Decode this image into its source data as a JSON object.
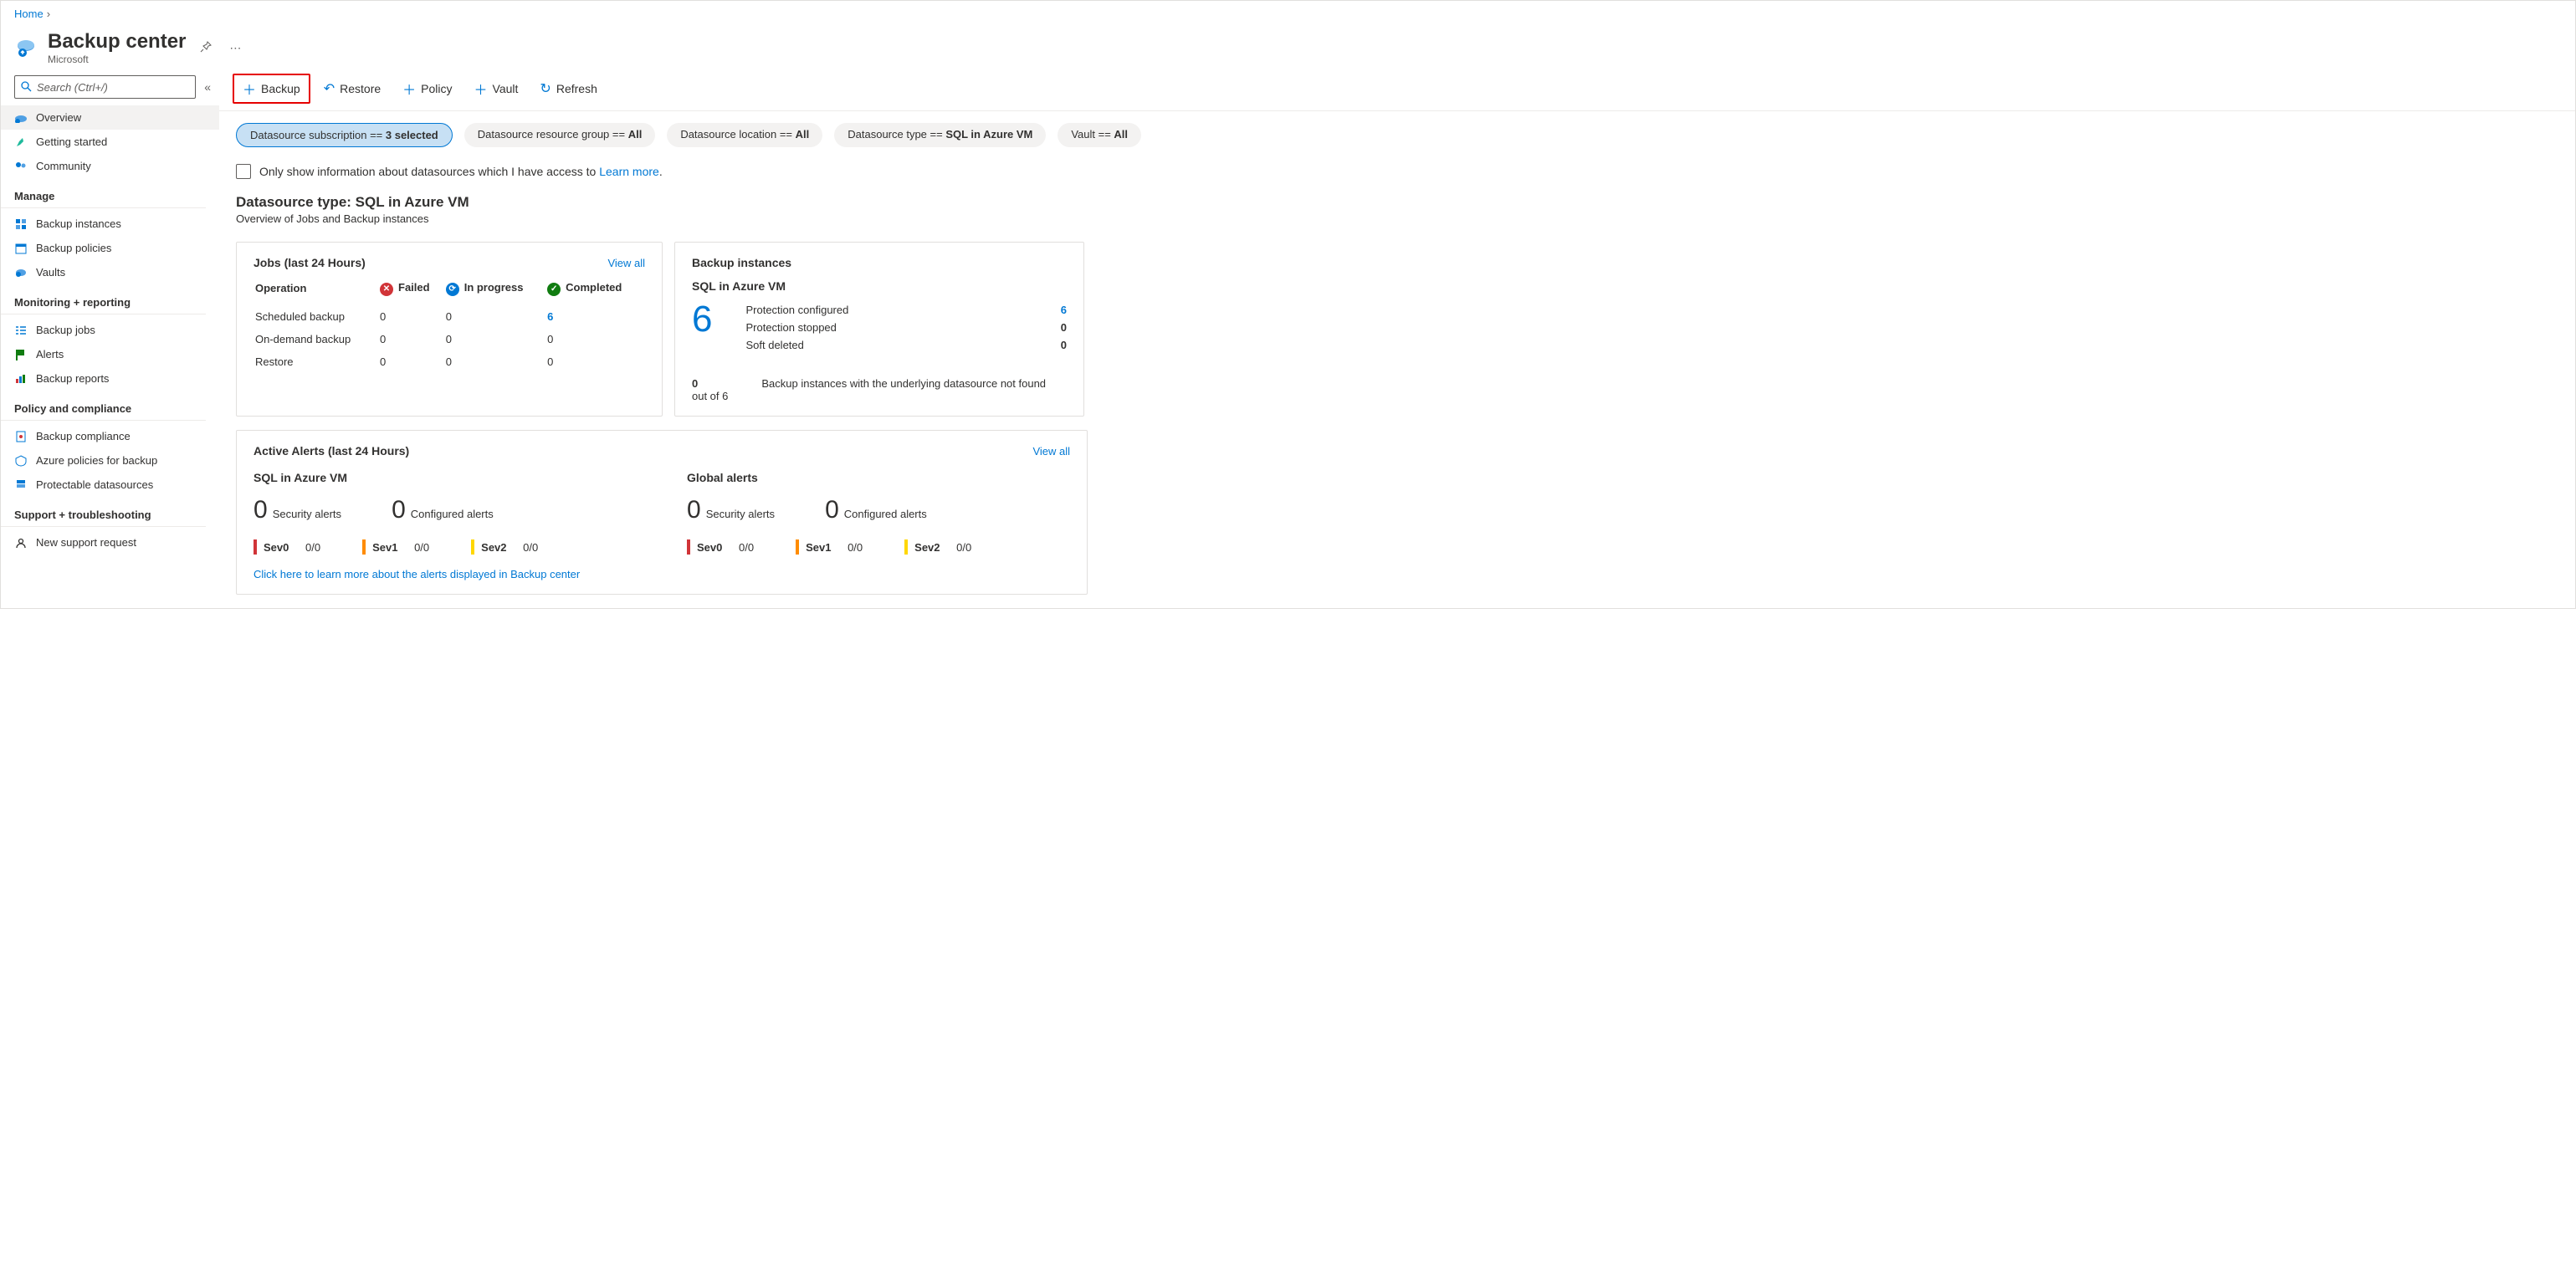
{
  "breadcrumb": {
    "home": "Home"
  },
  "header": {
    "title": "Backup center",
    "subtitle": "Microsoft"
  },
  "search": {
    "placeholder": "Search (Ctrl+/)"
  },
  "sidebar": {
    "items": [
      {
        "label": "Overview"
      },
      {
        "label": "Getting started"
      },
      {
        "label": "Community"
      }
    ],
    "manage_label": "Manage",
    "manage": [
      {
        "label": "Backup instances"
      },
      {
        "label": "Backup policies"
      },
      {
        "label": "Vaults"
      }
    ],
    "monitor_label": "Monitoring + reporting",
    "monitor": [
      {
        "label": "Backup jobs"
      },
      {
        "label": "Alerts"
      },
      {
        "label": "Backup reports"
      }
    ],
    "policy_label": "Policy and compliance",
    "policy": [
      {
        "label": "Backup compliance"
      },
      {
        "label": "Azure policies for backup"
      },
      {
        "label": "Protectable datasources"
      }
    ],
    "support_label": "Support + troubleshooting",
    "support": [
      {
        "label": "New support request"
      }
    ]
  },
  "toolbar": {
    "backup": "Backup",
    "restore": "Restore",
    "policy": "Policy",
    "vault": "Vault",
    "refresh": "Refresh"
  },
  "filters": {
    "sub_prefix": "Datasource subscription == ",
    "sub_value": "3 selected",
    "rg_prefix": "Datasource resource group == ",
    "rg_value": "All",
    "loc_prefix": "Datasource location == ",
    "loc_value": "All",
    "type_prefix": "Datasource type == ",
    "type_value": "SQL in Azure VM",
    "vault_prefix": "Vault == ",
    "vault_value": "All"
  },
  "info": {
    "text": "Only show information about datasources which I have access to ",
    "link": "Learn more"
  },
  "dsheading": {
    "title": "Datasource type: SQL in Azure VM",
    "subtitle": "Overview of Jobs and Backup instances"
  },
  "jobs": {
    "title": "Jobs (last 24 Hours)",
    "viewall": "View all",
    "col_op": "Operation",
    "col_failed": "Failed",
    "col_progress": "In progress",
    "col_completed": "Completed",
    "rows": [
      {
        "op": "Scheduled backup",
        "failed": "0",
        "progress": "0",
        "completed": "6"
      },
      {
        "op": "On-demand backup",
        "failed": "0",
        "progress": "0",
        "completed": "0"
      },
      {
        "op": "Restore",
        "failed": "0",
        "progress": "0",
        "completed": "0"
      }
    ]
  },
  "instances": {
    "title": "Backup instances",
    "sub": "SQL in Azure VM",
    "big": "6",
    "rows": [
      {
        "label": "Protection configured",
        "value": "6"
      },
      {
        "label": "Protection stopped",
        "value": "0"
      },
      {
        "label": "Soft deleted",
        "value": "0"
      }
    ],
    "note_count": "0",
    "note_sub": "out of 6",
    "note_text": "Backup instances with the underlying datasource not found"
  },
  "alerts": {
    "title": "Active Alerts (last 24 Hours)",
    "viewall": "View all",
    "col1": {
      "title": "SQL in Azure VM",
      "sec_n": "0",
      "sec_l": "Security alerts",
      "cfg_n": "0",
      "cfg_l": "Configured alerts",
      "sev0": "Sev0",
      "sev0v": "0/0",
      "sev1": "Sev1",
      "sev1v": "0/0",
      "sev2": "Sev2",
      "sev2v": "0/0"
    },
    "col2": {
      "title": "Global alerts",
      "sec_n": "0",
      "sec_l": "Security alerts",
      "cfg_n": "0",
      "cfg_l": "Configured alerts",
      "sev0": "Sev0",
      "sev0v": "0/0",
      "sev1": "Sev1",
      "sev1v": "0/0",
      "sev2": "Sev2",
      "sev2v": "0/0"
    },
    "link": "Click here to learn more about the alerts displayed in Backup center"
  }
}
